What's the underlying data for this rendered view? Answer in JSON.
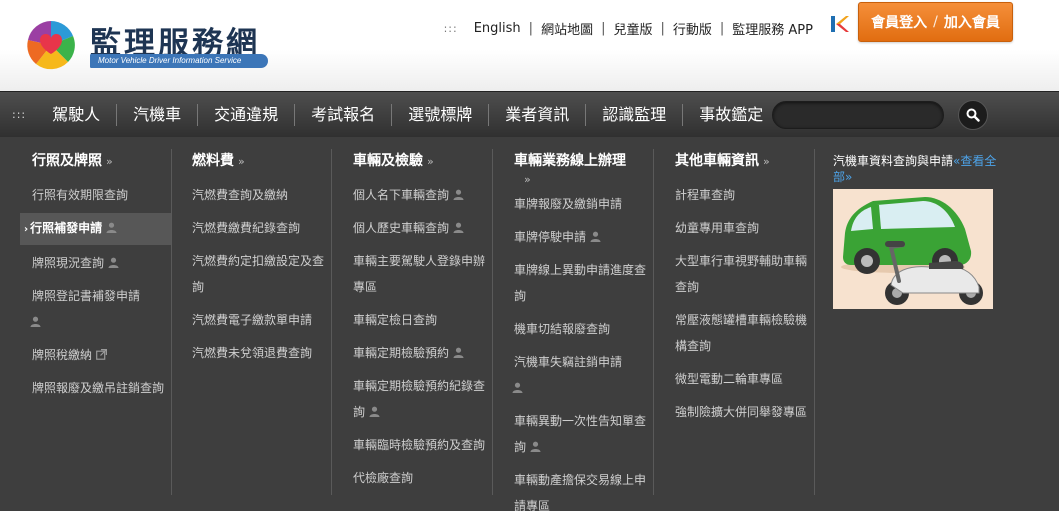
{
  "header": {
    "logo_title": "監理服務網",
    "logo_subtitle": "Motor Vehicle Driver Information Service",
    "top_links": [
      "English",
      "網站地圖",
      "兒童版",
      "行動版",
      "監理服務 APP"
    ],
    "grip": ":::",
    "login_label": "會員登入",
    "join_label": "加入會員",
    "separator": "/"
  },
  "nav": {
    "grip": ":::",
    "items": [
      "駕駛人",
      "汽機車",
      "交通違規",
      "考試報名",
      "選號標牌",
      "業者資訊",
      "認識監理",
      "事故鑑定"
    ],
    "search_placeholder": ""
  },
  "menu": {
    "chev": "»",
    "active_marker": "›",
    "columns": [
      {
        "title": "行照及牌照",
        "items": [
          {
            "label": "行照有效期限查詢",
            "user": false,
            "ext": false,
            "active": false
          },
          {
            "label": "行照補發申請",
            "user": true,
            "ext": false,
            "active": true
          },
          {
            "label": "牌照現況查詢",
            "user": true,
            "ext": false,
            "active": false
          },
          {
            "label": "牌照登記書補發申請",
            "user": true,
            "ext": false,
            "active": false
          },
          {
            "label": "牌照稅繳納",
            "user": false,
            "ext": true,
            "active": false
          },
          {
            "label": "牌照報廢及繳吊註銷查詢",
            "user": false,
            "ext": false,
            "active": false
          }
        ]
      },
      {
        "title": "燃料費",
        "items": [
          {
            "label": "汽燃費查詢及繳納",
            "user": false,
            "ext": false
          },
          {
            "label": "汽燃費繳費紀錄查詢",
            "user": false,
            "ext": false
          },
          {
            "label": "汽燃費約定扣繳設定及查詢",
            "user": false,
            "ext": false
          },
          {
            "label": "汽燃費電子繳款單申請",
            "user": false,
            "ext": false
          },
          {
            "label": "汽燃費未兌領退費查詢",
            "user": false,
            "ext": false
          }
        ]
      },
      {
        "title": "車輛及檢驗",
        "items": [
          {
            "label": "個人名下車輛查詢",
            "user": true,
            "ext": false
          },
          {
            "label": "個人歷史車輛查詢",
            "user": true,
            "ext": false
          },
          {
            "label": "車輛主要駕駛人登錄申辦專區",
            "user": false,
            "ext": false
          },
          {
            "label": "車輛定檢日查詢",
            "user": false,
            "ext": false
          },
          {
            "label": "車輛定期檢驗預約",
            "user": true,
            "ext": false
          },
          {
            "label": "車輛定期檢驗預約紀錄查詢",
            "user": true,
            "ext": false
          },
          {
            "label": "車輛臨時檢驗預約及查詢",
            "user": false,
            "ext": false
          },
          {
            "label": "代檢廠查詢",
            "user": false,
            "ext": false
          }
        ]
      },
      {
        "title": "車輛業務線上辦理",
        "items": [
          {
            "label": "車牌報廢及繳銷申請",
            "user": false,
            "ext": false
          },
          {
            "label": "車牌停駛申請",
            "user": true,
            "ext": false
          },
          {
            "label": "車牌線上異動申請進度查詢",
            "user": false,
            "ext": false
          },
          {
            "label": "機車切結報廢查詢",
            "user": false,
            "ext": false
          },
          {
            "label": "汽機車失竊註銷申請",
            "user": true,
            "ext": false
          },
          {
            "label": "車輛異動一次性告知單查詢",
            "user": true,
            "ext": false
          },
          {
            "label": "車輛動產擔保交易線上申請專區",
            "user": false,
            "ext": false
          }
        ]
      },
      {
        "title": "其他車輛資訊",
        "items": [
          {
            "label": "計程車查詢",
            "user": false,
            "ext": false
          },
          {
            "label": "幼童專用車查詢",
            "user": false,
            "ext": false
          },
          {
            "label": "大型車行車視野輔助車輛查詢",
            "user": false,
            "ext": false
          },
          {
            "label": "常壓液態罐槽車輛檢驗機構查詢",
            "user": false,
            "ext": false
          },
          {
            "label": "微型電動二輪車專區",
            "user": false,
            "ext": false
          },
          {
            "label": "強制險擴大併同舉發專區",
            "user": false,
            "ext": false
          }
        ]
      }
    ],
    "promo": {
      "title": "汽機車資料查詢與申請",
      "more": "«查看全部»"
    }
  },
  "colors": {
    "accent_orange": "#ee7b1f",
    "nav_bg": "#3e3e3e",
    "link_blue": "#4da3e8"
  }
}
